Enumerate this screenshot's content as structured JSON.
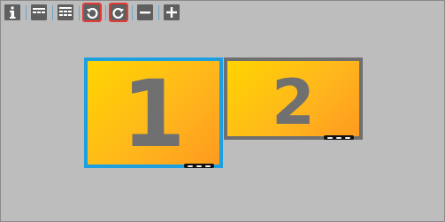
{
  "toolbar": {
    "buttons": [
      {
        "icon": "info-icon"
      },
      {
        "icon": "layout-row-icon"
      },
      {
        "icon": "layout-grid-icon"
      },
      {
        "icon": "rotate-left-icon",
        "highlighted": true
      },
      {
        "icon": "rotate-right-icon",
        "highlighted": true
      },
      {
        "icon": "zoom-out-icon"
      },
      {
        "icon": "zoom-in-icon"
      }
    ]
  },
  "monitors": [
    {
      "label": "1",
      "selected": true,
      "border_color": "#1e9fe0"
    },
    {
      "label": "2",
      "selected": false,
      "border_color": "#6f6f6f"
    }
  ],
  "colors": {
    "background": "#bdbdbd",
    "monitor_fill_start": "#ffd400",
    "monitor_fill_end": "#ff9a1f",
    "number": "#707070",
    "highlight": "#e53935"
  }
}
